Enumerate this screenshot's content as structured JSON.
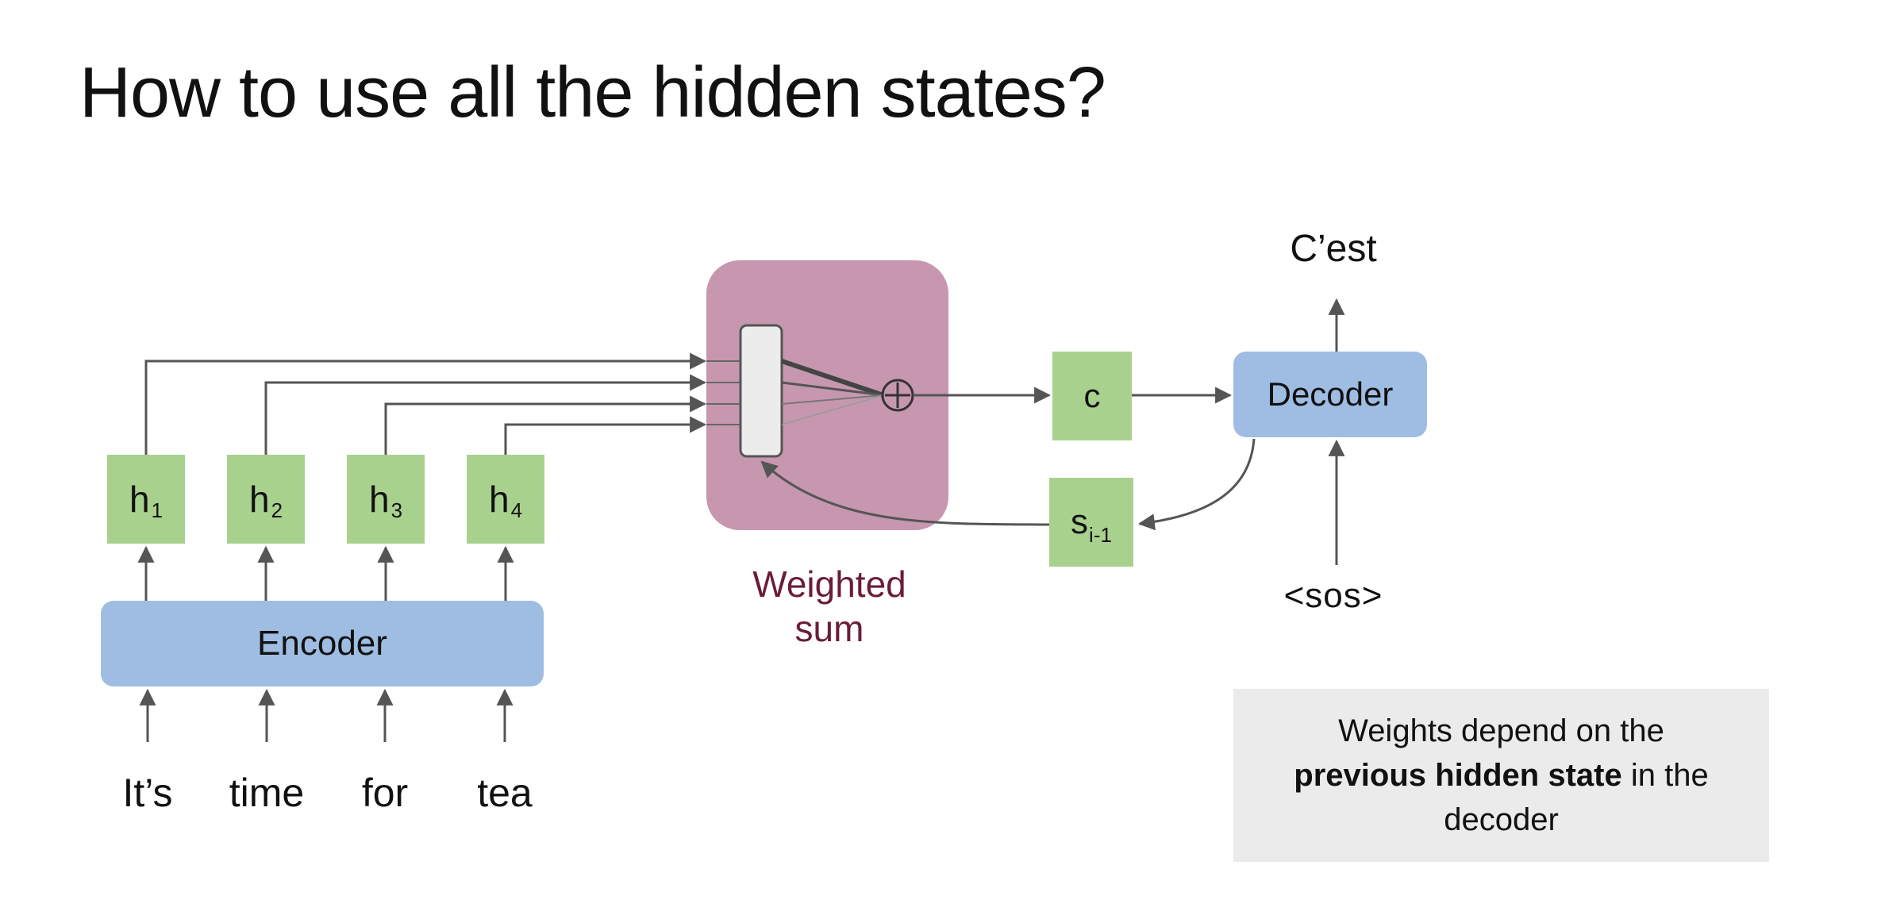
{
  "title": "How to use all the hidden states?",
  "encoder": {
    "label": "Encoder",
    "hidden_states": [
      {
        "symbol": "h",
        "subscript": "1"
      },
      {
        "symbol": "h",
        "subscript": "2"
      },
      {
        "symbol": "h",
        "subscript": "3"
      },
      {
        "symbol": "h",
        "subscript": "4"
      }
    ],
    "input_words": [
      "It’s",
      "time",
      "for",
      "tea"
    ]
  },
  "attention": {
    "label_line1": "Weighted",
    "label_line2": "sum"
  },
  "context": {
    "label": "c"
  },
  "previous_state": {
    "symbol": "s",
    "subscript": "i-1"
  },
  "decoder": {
    "label": "Decoder",
    "output_word": "C’est",
    "input_token": "<sos>"
  },
  "note": {
    "before": "Weights depend on the",
    "bold": "previous hidden state",
    "after": "in the",
    "end": "decoder"
  },
  "colors": {
    "green_box": "#a9d18e",
    "blue_box": "#9fbde2",
    "attention_box": "#c797b0",
    "attention_label": "#6b1d36",
    "note_background": "#ebebeb",
    "arrow": "#555555"
  }
}
